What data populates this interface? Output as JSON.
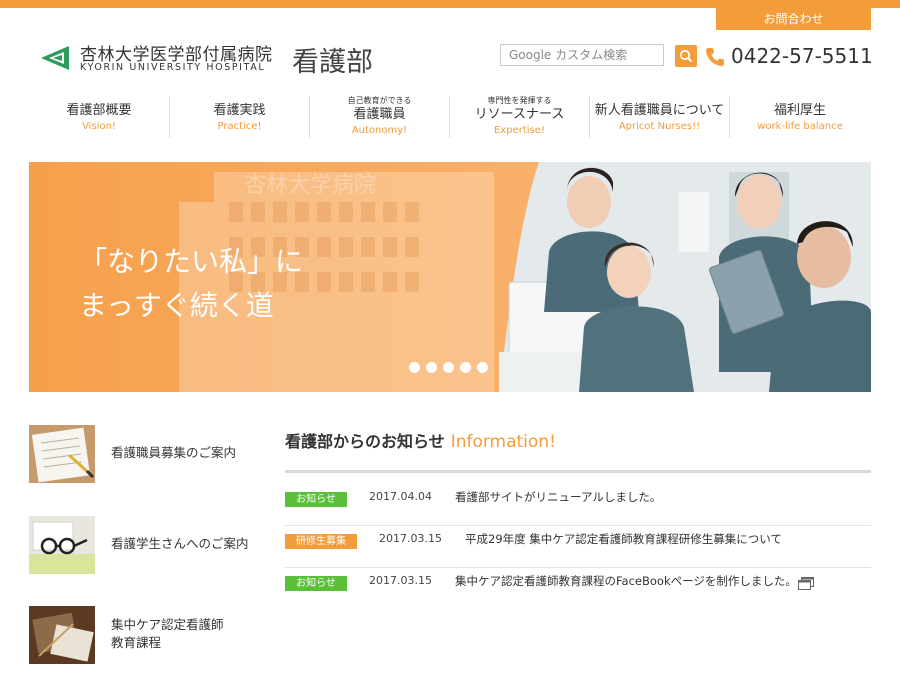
{
  "header": {
    "contact_label": "お問合わせ",
    "logo_jp": "杏林大学医学部付属病院",
    "logo_en": "KYORIN UNIVERSITY HOSPITAL",
    "department": "看護部",
    "search_placeholder": "Google カスタム検索",
    "phone": "0422-57-5511"
  },
  "nav": {
    "items": [
      {
        "sub": "",
        "label": "看護部概要",
        "en": "Vision!"
      },
      {
        "sub": "",
        "label": "看護実践",
        "en": "Practice!"
      },
      {
        "sub": "自己教育ができる",
        "label": "看護職員",
        "en": "Autonomy!"
      },
      {
        "sub": "専門性を発揮する",
        "label": "リソースナース",
        "en": "Expertise!"
      },
      {
        "sub": "",
        "label": "新人看護職員について",
        "en": "Apricot Nurses!!"
      },
      {
        "sub": "",
        "label": "福利厚生",
        "en": "work-life balance"
      }
    ]
  },
  "hero": {
    "line1": "「なりたい私」に",
    "line2": "まっすぐ続く道",
    "building_sign": "杏林大学病院",
    "slides": 5,
    "active_slide": 1
  },
  "sidebar": {
    "items": [
      {
        "label": "看護職員募集のご案内"
      },
      {
        "label": "看護学生さんへのご案内"
      },
      {
        "label_line1": "集中ケア認定看護師",
        "label_line2": "教育課程"
      }
    ]
  },
  "news": {
    "title_jp": "看護部からのお知らせ",
    "title_en": "Information!",
    "items": [
      {
        "badge": "お知らせ",
        "badge_color": "#5cbf3a",
        "date": "2017.04.04",
        "text": "看護部サイトがリニューアルしました。"
      },
      {
        "badge": "研修生募集",
        "badge_color": "#f39c3a",
        "date": "2017.03.15",
        "text": "平成29年度 集中ケア認定看護師教育課程研修生募集について"
      },
      {
        "badge": "お知らせ",
        "badge_color": "#5cbf3a",
        "date": "2017.03.15",
        "text": "集中ケア認定看護師教育課程のFaceBookページを制作しました。"
      }
    ]
  },
  "colors": {
    "accent": "#f39c3a",
    "green": "#5cbf3a",
    "logo_green": "#2e9a5e"
  }
}
